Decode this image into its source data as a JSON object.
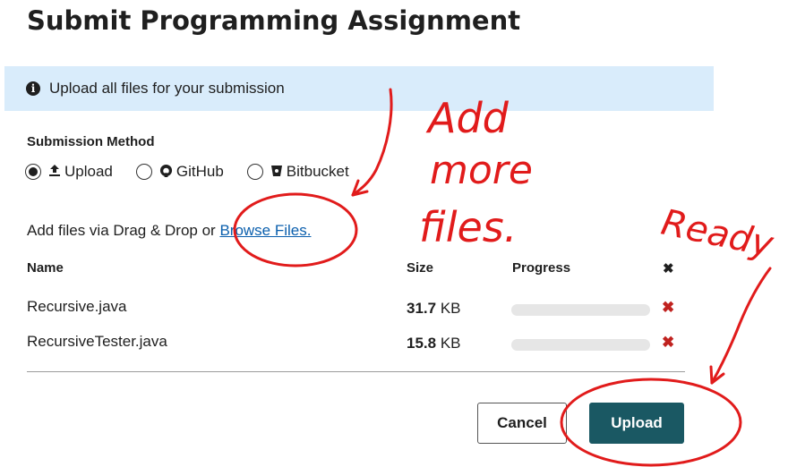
{
  "page": {
    "title": "Submit Programming Assignment"
  },
  "banner": {
    "icon": "info-icon",
    "text": "Upload all files for your submission"
  },
  "submission": {
    "label": "Submission Method",
    "methods": [
      {
        "label": "Upload",
        "icon": "upload-icon",
        "selected": true
      },
      {
        "label": "GitHub",
        "icon": "github-icon",
        "selected": false
      },
      {
        "label": "Bitbucket",
        "icon": "bitbucket-icon",
        "selected": false
      }
    ]
  },
  "files": {
    "add_text": "Add files via Drag & Drop or",
    "browse_label": "Browse Files.",
    "columns": {
      "name": "Name",
      "size": "Size",
      "progress": "Progress",
      "remove": "✖"
    },
    "rows": [
      {
        "name": "Recursive.java",
        "size_value": "31.7",
        "size_unit": "KB",
        "progress": 0
      },
      {
        "name": "RecursiveTester.java",
        "size_value": "15.8",
        "size_unit": "KB",
        "progress": 0
      }
    ]
  },
  "actions": {
    "cancel_label": "Cancel",
    "upload_label": "Upload"
  },
  "annotations": {
    "note_add": [
      "Add",
      "more",
      "files."
    ],
    "note_ready": "Ready",
    "color": "#e11b1b"
  },
  "colors": {
    "banner_bg": "#d9ecfb",
    "link": "#0b5fad",
    "upload_button": "#1a5863",
    "delete": "#c0221f"
  }
}
